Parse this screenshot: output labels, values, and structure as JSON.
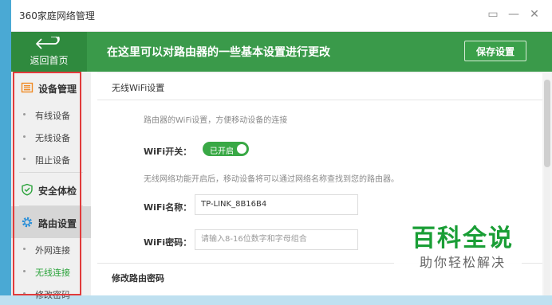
{
  "window": {
    "title": "360家庭网络管理",
    "controls": {
      "feedback": "▭",
      "minimize": "—",
      "close": "✕"
    }
  },
  "header": {
    "back_label": "返回首页",
    "message": "在这里可以对路由器的一些基本设置进行更改",
    "save_label": "保存设置"
  },
  "sidebar": {
    "sections": [
      {
        "label": "设备管理",
        "icon": "device-list-icon",
        "color": "#f08a24"
      },
      {
        "label": "安全体检",
        "icon": "shield-icon",
        "color": "#2aa33a"
      },
      {
        "label": "路由设置",
        "icon": "gear-icon",
        "color": "#2a8fd8"
      }
    ],
    "device_items": [
      "有线设备",
      "无线设备",
      "阻止设备"
    ],
    "router_items": [
      "外网连接",
      "无线连接",
      "修改密码"
    ],
    "active_item": "无线连接"
  },
  "content": {
    "section_title": "无线WiFi设置",
    "description": "路由器的WiFi设置，方便移动设备的连接",
    "wifi_switch_label": "WiFi开关：",
    "wifi_switch_state": "已开启",
    "hint": "无线网络功能开启后，移动设备将可以通过网络名称查找到您的路由器。",
    "wifi_name_label": "WiFi名称：",
    "wifi_name_value": "TP-LINK_8B16B4",
    "wifi_password_label": "WiFi密码：",
    "wifi_password_placeholder": "请输入8-16位数字和字母组合",
    "section2_title": "修改路由密码"
  },
  "watermark": {
    "title": "百科全说",
    "subtitle": "助你轻松解决"
  },
  "colors": {
    "header_green": "#3a9a4a",
    "accent_green": "#2aa33a",
    "highlight_red": "#e13b3b"
  }
}
